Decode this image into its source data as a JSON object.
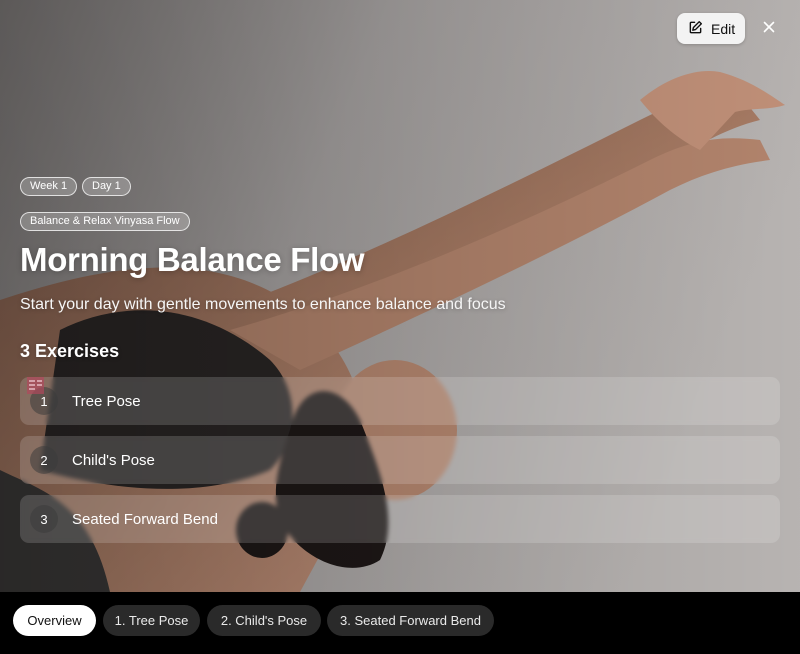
{
  "header": {
    "edit_label": "Edit"
  },
  "badges": {
    "week": "Week 1",
    "day": "Day 1",
    "program": "Balance & Relax Vinyasa Flow"
  },
  "workout": {
    "title": "Morning Balance Flow",
    "subtitle": "Start your day with gentle movements to enhance balance and focus",
    "exercise_count": "3 Exercises"
  },
  "exercises": [
    {
      "number": "1",
      "name": "Tree Pose"
    },
    {
      "number": "2",
      "name": "Child's Pose"
    },
    {
      "number": "3",
      "name": "Seated Forward Bend"
    }
  ],
  "tabs": [
    {
      "label": "Overview",
      "active": true
    },
    {
      "label": "1. Tree Pose",
      "active": false
    },
    {
      "label": "2. Child's Pose",
      "active": false
    },
    {
      "label": "3. Seated Forward Bend",
      "active": false
    }
  ],
  "icons": {
    "edit": "edit-icon",
    "close": "close-icon"
  },
  "colors": {
    "tab_active_bg": "#ffffff",
    "tab_bg": "#2a2a2a",
    "edit_bg": "#f3f3f3"
  }
}
